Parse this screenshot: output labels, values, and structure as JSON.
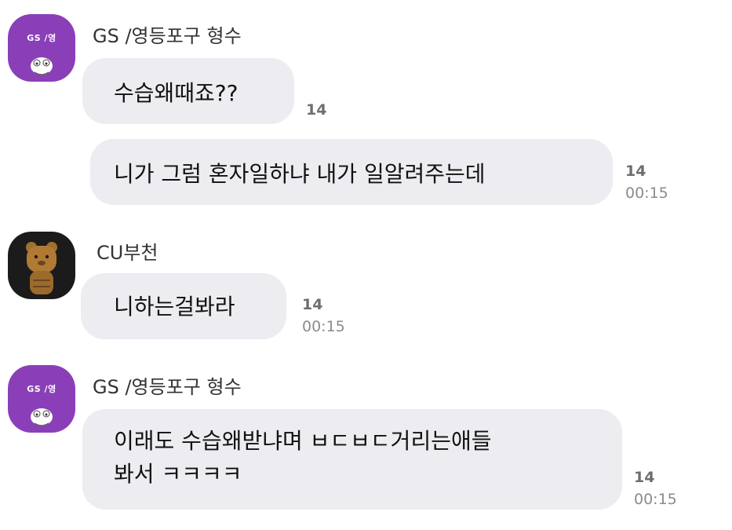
{
  "messages": [
    {
      "sender": "GS /영등포구 형수",
      "avatar_text": "GS /영",
      "bubbles": [
        {
          "text": "수습왜때죠??",
          "read_count": "14",
          "time": ""
        },
        {
          "text": "니가 그럼 혼자일하냐 내가 일알려주는데",
          "read_count": "14",
          "time": "00:15"
        }
      ]
    },
    {
      "sender": "CU부천",
      "avatar_text": "",
      "bubbles": [
        {
          "text": "니하는걸봐라",
          "read_count": "14",
          "time": "00:15"
        }
      ]
    },
    {
      "sender": "GS /영등포구 형수",
      "avatar_text": "GS /영",
      "bubbles": [
        {
          "line1": "이래도 수습왜받냐며 ㅂㄷㅂㄷ거리는애들",
          "line2": "봐서 ㅋㅋㅋㅋ",
          "read_count": "14",
          "time": "00:15"
        }
      ]
    }
  ],
  "colors": {
    "bubble": "#ececf1",
    "gs_avatar": "#8a3fb8",
    "cu_avatar": "#1b1b1b",
    "meta_text": "#8b8b8b"
  }
}
